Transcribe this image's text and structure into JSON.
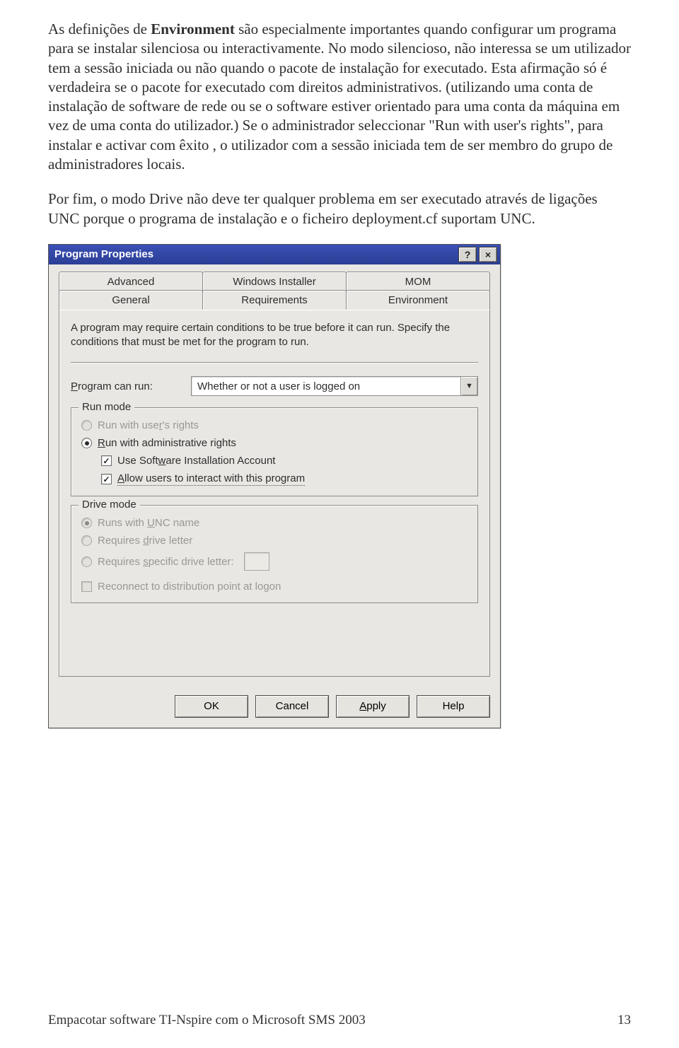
{
  "doc": {
    "para1a": "As definições de ",
    "para1b": "Environment",
    "para1c": " são especialmente importantes quando configurar um programa para se instalar silenciosa ou interactivamente. No modo silencioso, não interessa se um utilizador tem a sessão iniciada ou não quando o pacote de instalação for executado. Esta afirmação só é verdadeira se o pacote for executado com direitos administrativos. (utilizando uma conta de instalação de software de rede ou se o software estiver orientado para uma conta da máquina em vez de uma conta do utilizador.) Se o administrador seleccionar \"Run with user's rights\", para instalar e activar com êxito , o utilizador com a sessão iniciada tem de ser membro do grupo de administradores locais.",
    "para2": "Por fim, o modo Drive não deve ter qualquer problema em ser executado através de ligações UNC porque o programa de instalação e o ficheiro deployment.cf suportam UNC."
  },
  "dialog": {
    "title": "Program Properties",
    "help_btn": "?",
    "close_btn": "×",
    "tabs": {
      "advanced": "Advanced",
      "windows_installer": "Windows Installer",
      "mom": "MOM",
      "general": "General",
      "requirements": "Requirements",
      "environment": "Environment"
    },
    "desc": "A program may require certain conditions to be true before it can run. Specify the conditions that must be met for the program to run.",
    "program_can_run_label": "Program can run:",
    "program_can_run_value": "Whether or not a user is logged on",
    "run_mode": {
      "legend": "Run mode",
      "user_rights": "Run with user's rights",
      "admin_rights": "Run with administrative rights",
      "use_sw_account": "Use Software Installation Account",
      "allow_interact": "Allow users to interact with this program"
    },
    "drive_mode": {
      "legend": "Drive mode",
      "unc": "Runs with UNC name",
      "drive_letter": "Requires drive letter",
      "specific_letter": "Requires specific drive letter:",
      "reconnect": "Reconnect to distribution point at logon"
    },
    "buttons": {
      "ok": "OK",
      "cancel": "Cancel",
      "apply": "Apply",
      "help": "Help"
    }
  },
  "footer": {
    "left": "Empacotar software TI-Nspire com o Microsoft SMS 2003",
    "right": "13"
  }
}
